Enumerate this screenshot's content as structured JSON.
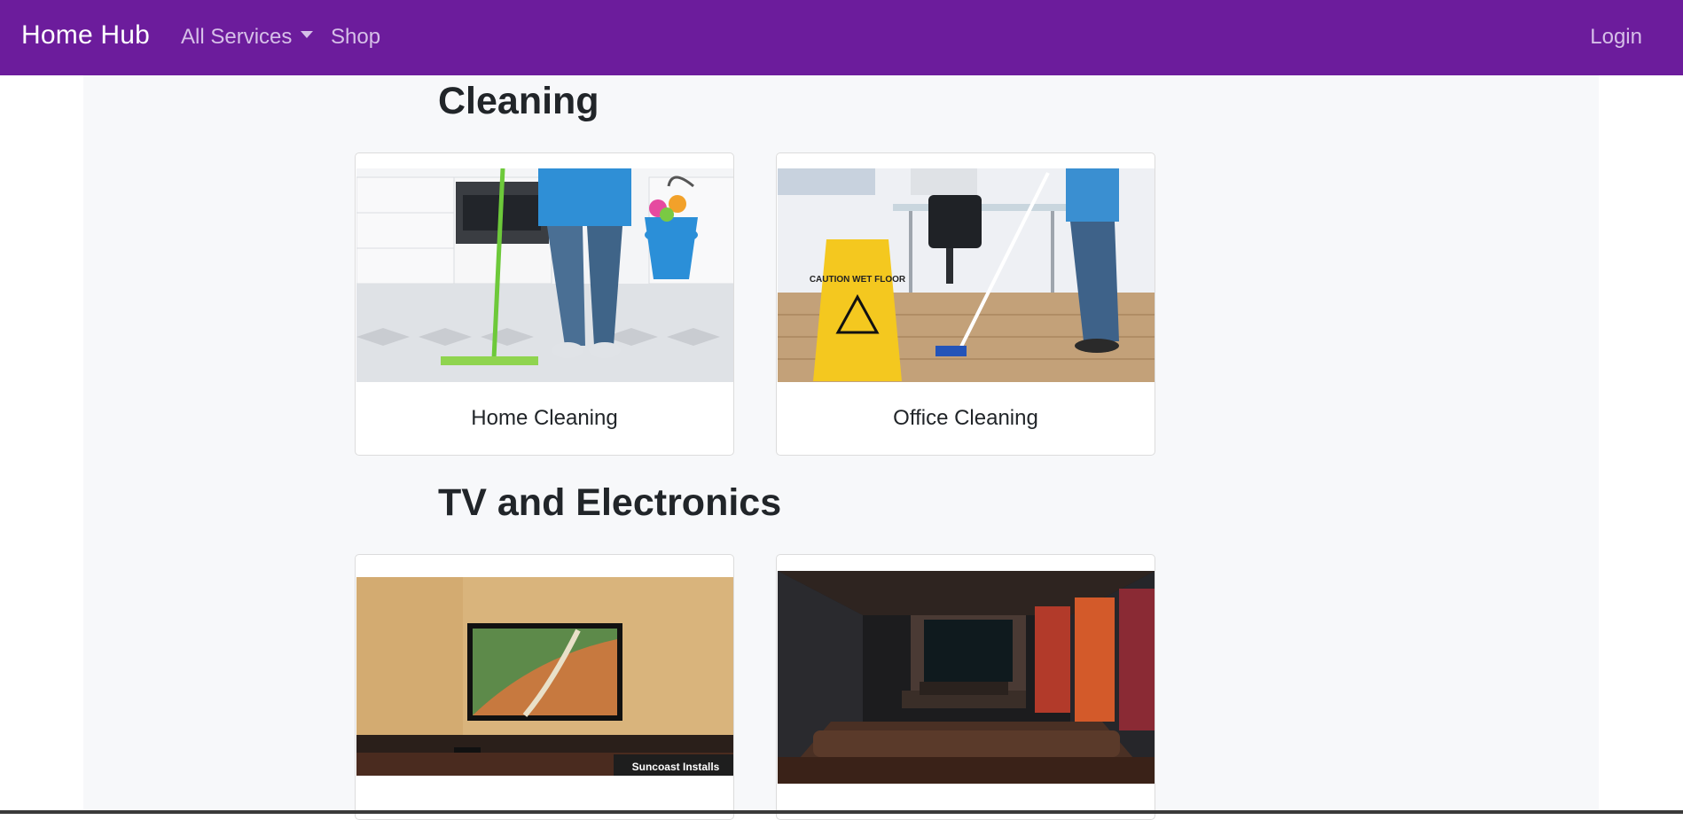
{
  "navbar": {
    "brand": "Home Hub",
    "links": {
      "all_services": "All Services",
      "shop": "Shop",
      "login": "Login"
    }
  },
  "sections": [
    {
      "title": "Cleaning",
      "cards": [
        {
          "label": "Home Cleaning",
          "image": "home-cleaning-photo"
        },
        {
          "label": "Office Cleaning",
          "image": "office-cleaning-photo"
        }
      ]
    },
    {
      "title": "TV and Electronics",
      "cards": [
        {
          "label": "",
          "image": "tv-mounting-photo",
          "watermark": "Suncoast Installs"
        },
        {
          "label": "",
          "image": "home-theater-photo"
        }
      ]
    }
  ],
  "images": {
    "wet_floor_sign": "CAUTION WET FLOOR"
  }
}
